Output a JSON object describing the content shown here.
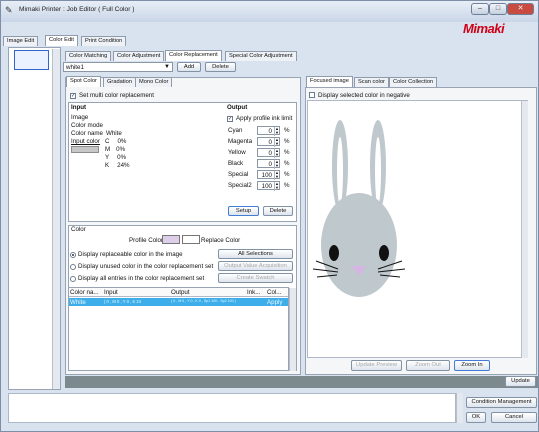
{
  "window": {
    "title": "Mimaki Printer : Job Editor ( Full Color )",
    "brand": "Mimaki",
    "buttons": [
      "–",
      "□",
      "✕"
    ]
  },
  "main_tabs": [
    "Image Edit",
    "Color Edit",
    "Print Condition"
  ],
  "sub_tabs": [
    "Color Matching",
    "Color Adjustment",
    "Color Replacement",
    "Special Color Adjustment"
  ],
  "preset": {
    "value": "white1",
    "add": "Add",
    "delete": "Delete"
  },
  "left_tabs": [
    "Spot Color",
    "Gradation",
    "Mono Color"
  ],
  "set_multi": "Set multi color replacement",
  "input": {
    "header": "Input",
    "image": "Image",
    "color_mode": "Color mode",
    "color_name_label": "Color name",
    "color_name": "White",
    "input_color": "Input color",
    "channels": [
      {
        "label": "C",
        "value": "0%"
      },
      {
        "label": "M",
        "value": "0%"
      },
      {
        "label": "Y",
        "value": "0%"
      },
      {
        "label": "K",
        "value": "24%"
      }
    ]
  },
  "output": {
    "header": "Output",
    "apply_profile": "Apply profile ink limit",
    "rows": [
      {
        "label": "Cyan",
        "value": "0",
        "unit": "%"
      },
      {
        "label": "Magenta",
        "value": "0",
        "unit": "%"
      },
      {
        "label": "Yellow",
        "value": "0",
        "unit": "%"
      },
      {
        "label": "Black",
        "value": "0",
        "unit": "%"
      },
      {
        "label": "Special",
        "value": "100",
        "unit": "%"
      },
      {
        "label": "Special2",
        "value": "100",
        "unit": "%"
      }
    ],
    "setup": "Setup",
    "delete": "Delete"
  },
  "color": {
    "header": "Color",
    "profile_color": "Profile Color",
    "replace_color": "Replace Color",
    "options": [
      "Display replaceable color in the image",
      "Display unused color in the color replacement set",
      "Display all entries in the color replacement set"
    ],
    "all_selections": "All Selections",
    "output_value": "Output Value Acquisition",
    "create_swatch": "Create Swatch"
  },
  "table": {
    "columns": [
      "Color na...",
      "Input",
      "Output",
      "Ink...",
      "Col..."
    ],
    "rows": [
      [
        "White",
        "( 0 , M 0 , Y 0 , K 24",
        "( 0 , M 0 , Y 0 , K 0 , Sp1 100 , Sp2 100 )",
        "",
        "Apply"
      ]
    ]
  },
  "right_tabs": [
    "Focused image",
    "Scan color",
    "Color Collection"
  ],
  "display_negative": "Display selected color in negative",
  "preview_buttons": {
    "update_preview": "Update Preview",
    "zoom_out": "Zoom Out",
    "zoom_in": "Zoom In"
  },
  "bottom": {
    "update": "Update",
    "condition": "Condition Management",
    "ok": "OK",
    "cancel": "Cancel"
  }
}
